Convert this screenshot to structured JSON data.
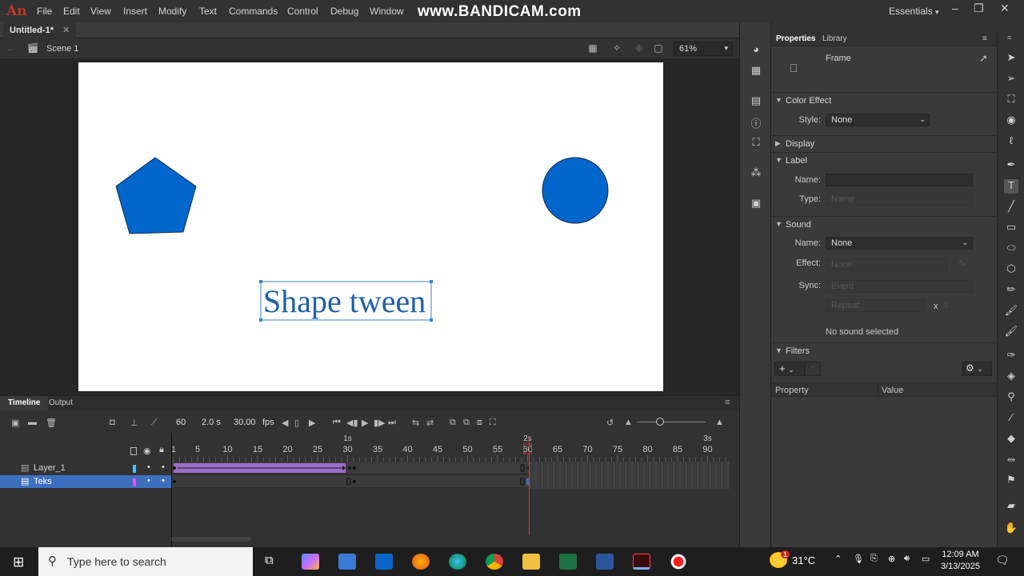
{
  "app": {
    "logo": "An",
    "menu": [
      "File",
      "Edit",
      "View",
      "Insert",
      "Modify",
      "Text",
      "Commands",
      "Control",
      "Debug",
      "Window"
    ],
    "watermark": "www.BANDICAM.com",
    "workspace": "Essentials"
  },
  "document": {
    "tab_title": "Untitled-1*",
    "scene": "Scene 1",
    "zoom": "61%"
  },
  "stage": {
    "text": "Shape tween",
    "shape_fill": "#0066cc"
  },
  "properties": {
    "tabs": [
      "Properties",
      "Library"
    ],
    "type": "Frame",
    "color_effect": {
      "title": "Color Effect",
      "style_label": "Style:",
      "style_value": "None"
    },
    "display_title": "Display",
    "label": {
      "title": "Label",
      "name_label": "Name:",
      "type_label": "Type:",
      "type_value": "Name"
    },
    "sound": {
      "title": "Sound",
      "name_label": "Name:",
      "name_value": "None",
      "effect_label": "Effect:",
      "effect_value": "None",
      "sync_label": "Sync:",
      "sync_value": "Event",
      "repeat_value": "Repeat",
      "repeat_x": "x",
      "status": "No sound selected"
    },
    "filters": {
      "title": "Filters",
      "col_property": "Property",
      "col_value": "Value"
    }
  },
  "timeline": {
    "tabs": [
      "Timeline",
      "Output"
    ],
    "current_frame": "60",
    "time": "2.0 s",
    "fps_value": "30.00",
    "fps_unit": "fps",
    "frame_ticks": [
      "1",
      "5",
      "10",
      "15",
      "20",
      "25",
      "30",
      "35",
      "40",
      "45",
      "50",
      "55",
      "60",
      "65",
      "70",
      "75",
      "80",
      "85",
      "90"
    ],
    "second_marks": [
      "1s",
      "2s",
      "3s"
    ],
    "layers": [
      {
        "name": "Layer_1",
        "color": "#33ccff",
        "selected": false
      },
      {
        "name": "Teks",
        "color": "#ff44ff",
        "selected": true
      }
    ]
  },
  "taskbar": {
    "search_placeholder": "Type here to search",
    "weather_badge": "1",
    "temperature": "31°C",
    "time": "12:09 AM",
    "date": "3/13/2025"
  }
}
